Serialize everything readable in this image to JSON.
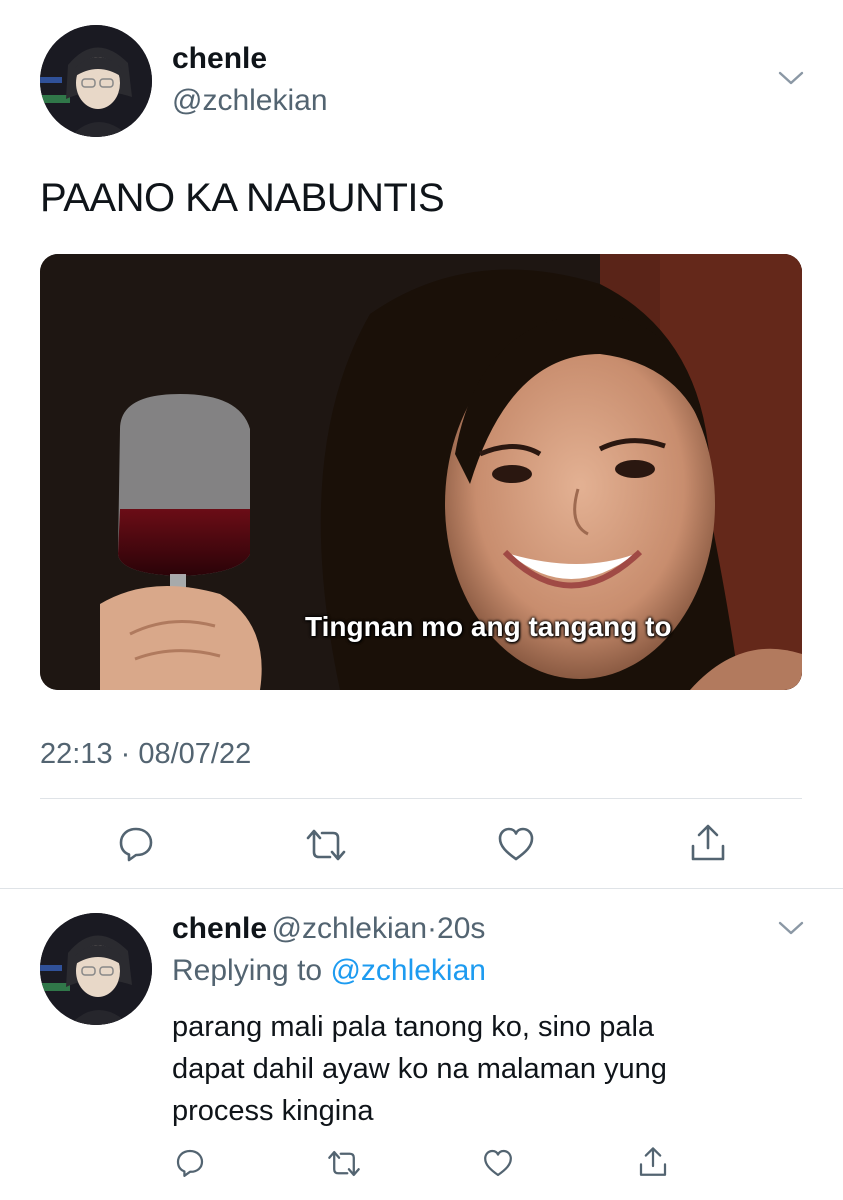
{
  "main_tweet": {
    "author": {
      "display_name": "chenle",
      "handle": "@zchlekian",
      "avatar_icon": "profile-photo"
    },
    "text": "PAANO KA NABUNTIS",
    "media": {
      "caption": "Tingnan mo ang tangang to"
    },
    "timestamp": "22:13 · 08/07/22",
    "actions": [
      "reply-icon",
      "retweet-icon",
      "like-icon",
      "share-icon"
    ]
  },
  "reply_tweet": {
    "author": {
      "display_name": "chenle",
      "handle": "@zchlekian",
      "age": "20s"
    },
    "replying_prefix": "Replying to",
    "replying_handle": "@zchlekian",
    "lines": [
      "parang mali pala tanong ko, sino pala",
      "dapat dahil ayaw ko na malaman yung",
      "process kingina"
    ],
    "actions": [
      "reply-icon",
      "retweet-icon",
      "like-icon",
      "share-icon"
    ]
  },
  "colors": {
    "text": "#0f1419",
    "secondary": "#536471",
    "link": "#1d9bf0",
    "divider": "#dfe3e7"
  }
}
